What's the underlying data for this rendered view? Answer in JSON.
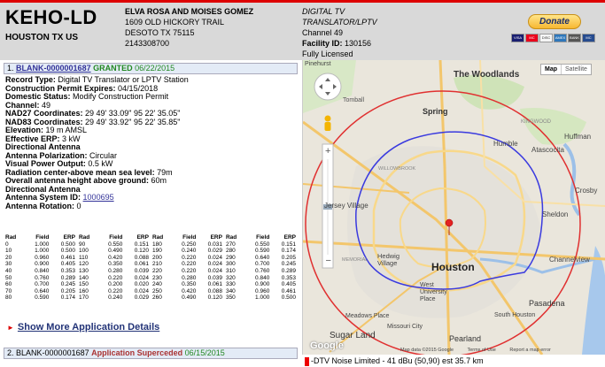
{
  "header": {
    "callsign": "KEHO-LD",
    "city_state": "HOUSTON TX US",
    "owner": {
      "name": "ELVA ROSA AND MOISES GOMEZ",
      "address": "1609 OLD HICKORY TRAIL",
      "city": "DESOTO TX 75115",
      "phone": "2143308700"
    },
    "service": {
      "type_line1": "DIGITAL TV",
      "type_line2": "TRANSLATOR/LPTV",
      "channel": "Channel 49",
      "facility_label": "Facility ID:",
      "facility_id": "130156",
      "status": "Fully Licensed"
    },
    "donate_label": "Donate",
    "cards": [
      "VISA",
      "MC",
      "DISC",
      "AMEX",
      "BANK",
      "MC"
    ]
  },
  "application1": {
    "index": "1.",
    "link": "BLANK-0000001687",
    "status": "GRANTED",
    "date": "06/22/2015",
    "details": {
      "record_type_label": "Record Type:",
      "record_type": "Digital TV Translator or LPTV Station",
      "cp_expires_label": "Construction Permit Expires:",
      "cp_expires": "04/15/2018",
      "domestic_status_label": "Domestic Status:",
      "domestic_status": "Modify Construction Permit",
      "channel_label": "Channel:",
      "channel": "49",
      "nad27_label": "NAD27 Coordinates:",
      "nad27": "29 49' 33.09\" 95 22' 35.05\"",
      "nad83_label": "NAD83 Coordinates:",
      "nad83": "29 49' 33.92\" 95 22' 35.85\"",
      "elevation_label": "Elevation:",
      "elevation": "19 m AMSL",
      "erp_label": "Effective ERP:",
      "erp": "3 kW",
      "directional_antenna_1": "Directional Antenna",
      "polarization_label": "Antenna Polarization:",
      "polarization": "Circular",
      "visual_power_label": "Visual Power Output:",
      "visual_power": "0.5 kW",
      "rc_amsl_label": "Radiation center-above mean sea level:",
      "rc_amsl": "79m",
      "overall_height_label": "Overall antenna height above ground:",
      "overall_height": "60m",
      "directional_antenna_2": "Directional Antenna",
      "antenna_system_label": "Antenna System ID:",
      "antenna_system_id": "1000695",
      "rotation_label": "Antenna Rotation:",
      "rotation": "0"
    },
    "radiation_headers": [
      "Rad",
      "Field",
      "ERP",
      "Rad",
      "Field",
      "ERP",
      "Rad",
      "Field",
      "ERP",
      "Rad",
      "Field",
      "ERP"
    ],
    "radiation_rows": [
      [
        "0",
        "1.000",
        "0.500",
        "90",
        "0.550",
        "0.151",
        "180",
        "0.250",
        "0.031",
        "270",
        "0.550",
        "0.151"
      ],
      [
        "10",
        "1.000",
        "0.500",
        "100",
        "0.490",
        "0.120",
        "190",
        "0.240",
        "0.029",
        "280",
        "0.590",
        "0.174"
      ],
      [
        "20",
        "0.960",
        "0.461",
        "110",
        "0.420",
        "0.088",
        "200",
        "0.220",
        "0.024",
        "290",
        "0.640",
        "0.205"
      ],
      [
        "30",
        "0.900",
        "0.405",
        "120",
        "0.350",
        "0.061",
        "210",
        "0.220",
        "0.024",
        "300",
        "0.700",
        "0.245"
      ],
      [
        "40",
        "0.840",
        "0.353",
        "130",
        "0.280",
        "0.039",
        "220",
        "0.220",
        "0.024",
        "310",
        "0.760",
        "0.289"
      ],
      [
        "50",
        "0.760",
        "0.289",
        "140",
        "0.220",
        "0.024",
        "230",
        "0.280",
        "0.039",
        "320",
        "0.840",
        "0.353"
      ],
      [
        "60",
        "0.700",
        "0.245",
        "150",
        "0.200",
        "0.020",
        "240",
        "0.350",
        "0.061",
        "330",
        "0.900",
        "0.405"
      ],
      [
        "70",
        "0.640",
        "0.205",
        "160",
        "0.220",
        "0.024",
        "250",
        "0.420",
        "0.088",
        "340",
        "0.960",
        "0.461"
      ],
      [
        "80",
        "0.590",
        "0.174",
        "170",
        "0.240",
        "0.029",
        "260",
        "0.490",
        "0.120",
        "350",
        "1.000",
        "0.500"
      ]
    ],
    "show_more": "Show More Application Details"
  },
  "application2": {
    "index": "2.",
    "link": "BLANK-0000001687",
    "status": "Application Superceded",
    "date": "06/15/2015"
  },
  "map": {
    "type_map": "Map",
    "type_satellite": "Satellite",
    "labels": {
      "pinehurst": "Pinehurst",
      "the_woodlands": "The Woodlands",
      "tomball": "Tomball",
      "spring": "Spring",
      "kingwood": "KINGWOOD",
      "humble": "Humble",
      "huffman": "Huffman",
      "atascocita": "Atascocita",
      "willowbrook": "WILLOWBROOK",
      "jersey_village": "Jersey Village",
      "crosby": "Crosby",
      "sheldon": "Sheldon",
      "hedwig_village": "Hedwig Village",
      "memorial": "MEMORIAL",
      "houston": "Houston",
      "channelview": "Channelview",
      "west_university": "West University Place",
      "pasadena": "Pasadena",
      "south_houston": "South Houston",
      "meadows_place": "Meadows Place",
      "missouri_city": "Missouri City",
      "sugar_land": "Sugar Land",
      "pearland": "Pearland"
    },
    "footer": [
      "Map data ©2015 Google",
      "Terms of Use",
      "Report a map error"
    ],
    "google": "Google",
    "legend": "-DTV Noise Limited - 41 dBu (50,90) est 35.7 km"
  },
  "colors": {
    "header_bg": "#d9d9d9",
    "app_bar_bg": "#e3ebf6",
    "contour_noise_limited": "#e03030",
    "contour_inner": "#3a3adf",
    "granted": "#228822"
  }
}
